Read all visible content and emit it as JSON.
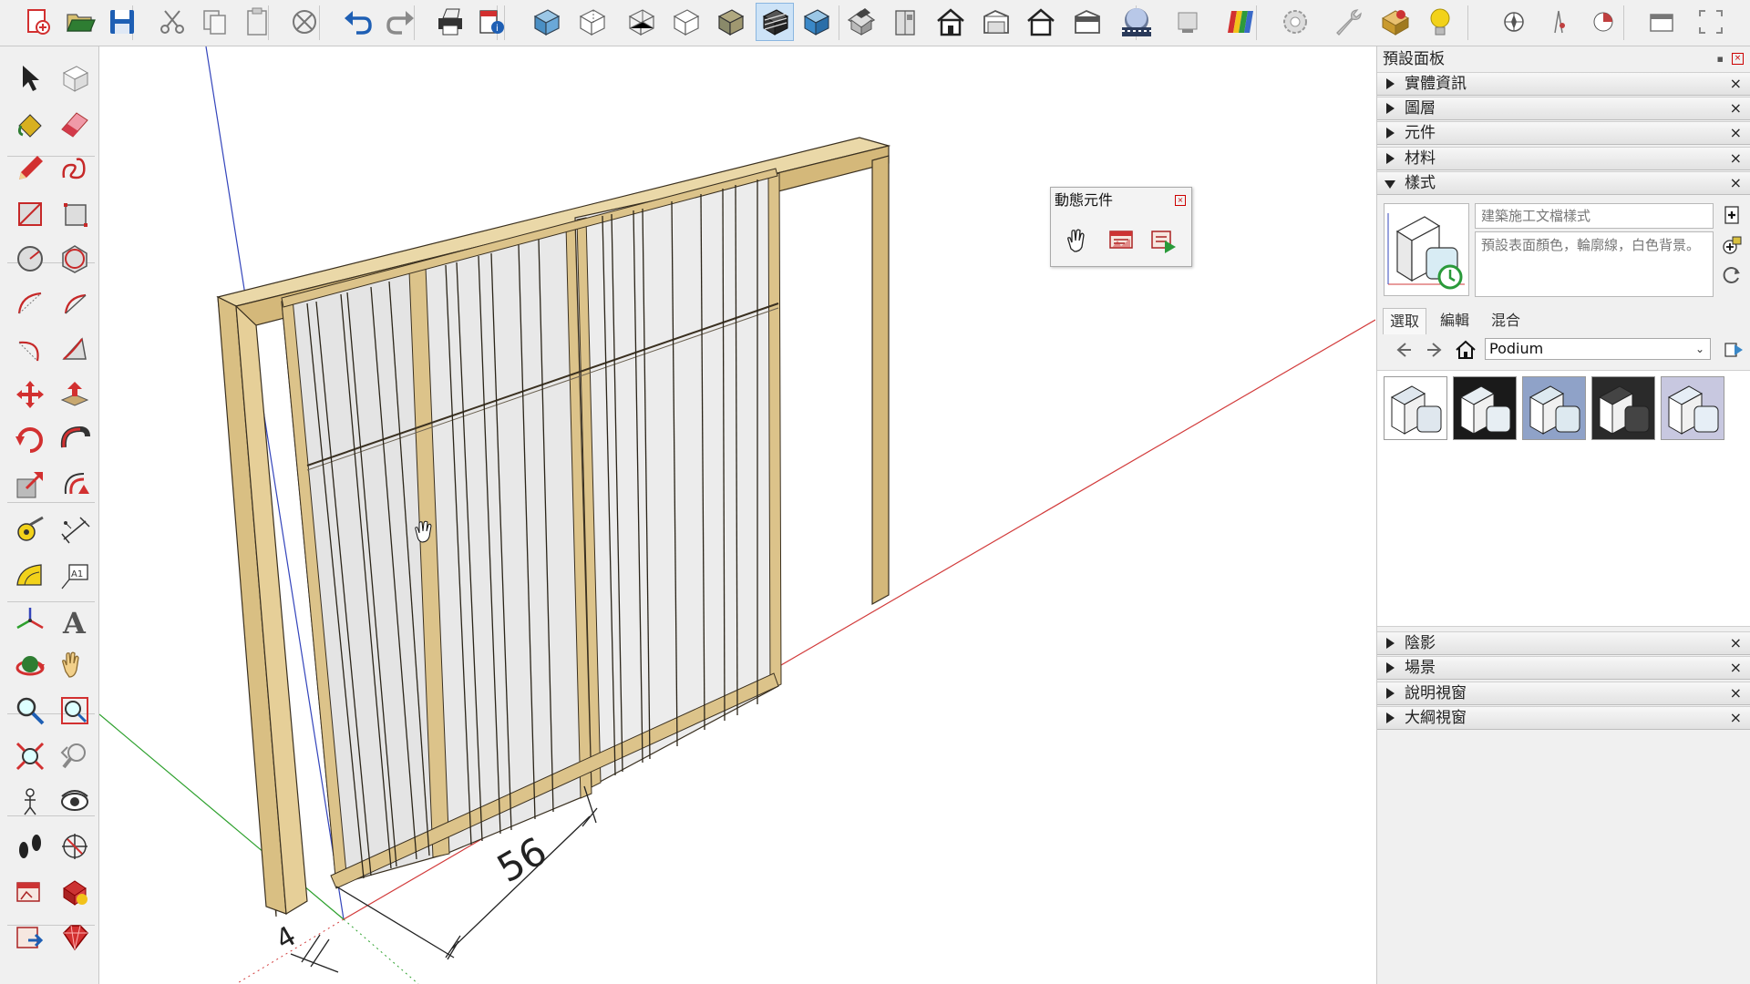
{
  "toolbar": {
    "items": [
      {
        "name": "new-file-icon",
        "color": "#d23030"
      },
      {
        "name": "open-folder-icon",
        "color": "#2e7d32"
      },
      {
        "name": "save-icon",
        "color": "#1e5fb4"
      },
      {
        "name": "cut-icon",
        "color": "#777777"
      },
      {
        "name": "copy-icon",
        "color": "#888888"
      },
      {
        "name": "paste-icon",
        "color": "#888888"
      },
      {
        "name": "erase-icon",
        "color": "#777777"
      },
      {
        "name": "undo-icon",
        "color": "#1e5fb4"
      },
      {
        "name": "redo-icon",
        "color": "#8a8a8a"
      },
      {
        "name": "print-icon",
        "color": "#333333"
      },
      {
        "name": "model-info-icon",
        "color": "#d23030"
      },
      {
        "name": "xray-icon",
        "color": "#4a8fc4"
      },
      {
        "name": "back-edges-icon",
        "color": "#666666"
      },
      {
        "name": "wireframe-icon",
        "color": "#666666"
      },
      {
        "name": "hidden-line-icon",
        "color": "#666666"
      },
      {
        "name": "shaded-icon",
        "color": "#8a8a6a"
      },
      {
        "name": "shaded-textures-icon",
        "color": "#333333"
      },
      {
        "name": "monochrome-icon",
        "color": "#3a88c8"
      },
      {
        "name": "iso-view-icon",
        "color": "#555555"
      },
      {
        "name": "top-view-icon",
        "color": "#555555"
      },
      {
        "name": "front-view-icon",
        "color": "#222222"
      },
      {
        "name": "right-view-icon",
        "color": "#555555"
      },
      {
        "name": "back-view-icon",
        "color": "#222222"
      },
      {
        "name": "left-view-icon",
        "color": "#555555"
      },
      {
        "name": "photo-textures-icon",
        "color": "#2a3a5a"
      },
      {
        "name": "display-icon",
        "color": "#888888"
      },
      {
        "name": "color-by-layer-icon",
        "color": "#d23030"
      },
      {
        "name": "settings-gear-icon",
        "color": "#999999"
      },
      {
        "name": "wrench-icon",
        "color": "#999999"
      },
      {
        "name": "extension-warehouse-icon",
        "color": "#c99a2e"
      },
      {
        "name": "light-bulb-icon",
        "color": "#f2d21a"
      },
      {
        "name": "location-icon",
        "color": "#555555"
      },
      {
        "name": "sandbox-icon",
        "color": "#c04040"
      },
      {
        "name": "pie-chart-icon",
        "color": "#c04040"
      },
      {
        "name": "window-icon",
        "color": "#777777"
      },
      {
        "name": "fullscreen-icon",
        "color": "#888888"
      }
    ]
  },
  "left_tools": {
    "items": [
      "select-icon",
      "component-icon",
      "paint-bucket-icon",
      "eraser-icon",
      "pencil-icon",
      "freehand-icon",
      "rectangle-icon",
      "rotated-rectangle-icon",
      "circle-icon",
      "polygon-icon",
      "arc-icon",
      "pie-icon",
      "three-point-arc-icon",
      "two-point-arc-icon",
      "move-icon",
      "push-pull-icon",
      "rotate-icon",
      "follow-me-icon",
      "scale-icon",
      "offset-icon",
      "tape-measure-icon",
      "dimension-icon",
      "protractor-icon",
      "text-icon",
      "axes-icon",
      "3d-text-icon",
      "orbit-icon",
      "pan-icon",
      "zoom-icon",
      "zoom-window-icon",
      "zoom-extents-icon",
      "previous-view-icon",
      "position-camera-icon",
      "look-around-icon",
      "walk-icon",
      "section-plane-icon",
      "dynamic-components-icon",
      "interact-icon",
      "send-to-layout-icon",
      "ruby-console-icon"
    ]
  },
  "viewport": {
    "dimension_labels": [
      "56",
      "4"
    ],
    "axis_colors": {
      "red": "#d23b3b",
      "green": "#2ca02c",
      "blue": "#3344bb"
    },
    "wood_color": "#dcc38a"
  },
  "dynamic_components": {
    "title": "動態元件",
    "icons": [
      "interact-icon",
      "component-options-icon",
      "component-attributes-icon"
    ]
  },
  "tray": {
    "title": "預設面板",
    "sections_top": [
      {
        "label": "實體資訊",
        "open": false
      },
      {
        "label": "圖層",
        "open": false
      },
      {
        "label": "元件",
        "open": false
      },
      {
        "label": "材料",
        "open": false
      },
      {
        "label": "樣式",
        "open": true
      }
    ],
    "styles": {
      "name": "建築施工文檔樣式",
      "description": "預設表面顏色，輪廓線，白色背景。",
      "tabs": [
        "選取",
        "編輯",
        "混合"
      ],
      "collection": "Podium",
      "swatches": [
        {
          "bg": "#ffffff",
          "fg": "#dfe7ee"
        },
        {
          "bg": "#1a1a1a",
          "fg": "#e7eef3"
        },
        {
          "bg": "#8fa2c8",
          "fg": "#dde9f0"
        },
        {
          "bg": "#2a2a2a",
          "fg": "#444444"
        },
        {
          "bg": "#c8c8e0",
          "fg": "#e6eef6"
        }
      ]
    },
    "sections_bottom": [
      {
        "label": "陰影",
        "open": false
      },
      {
        "label": "場景",
        "open": false
      },
      {
        "label": "說明視窗",
        "open": false
      },
      {
        "label": "大綱視窗",
        "open": false
      }
    ]
  }
}
